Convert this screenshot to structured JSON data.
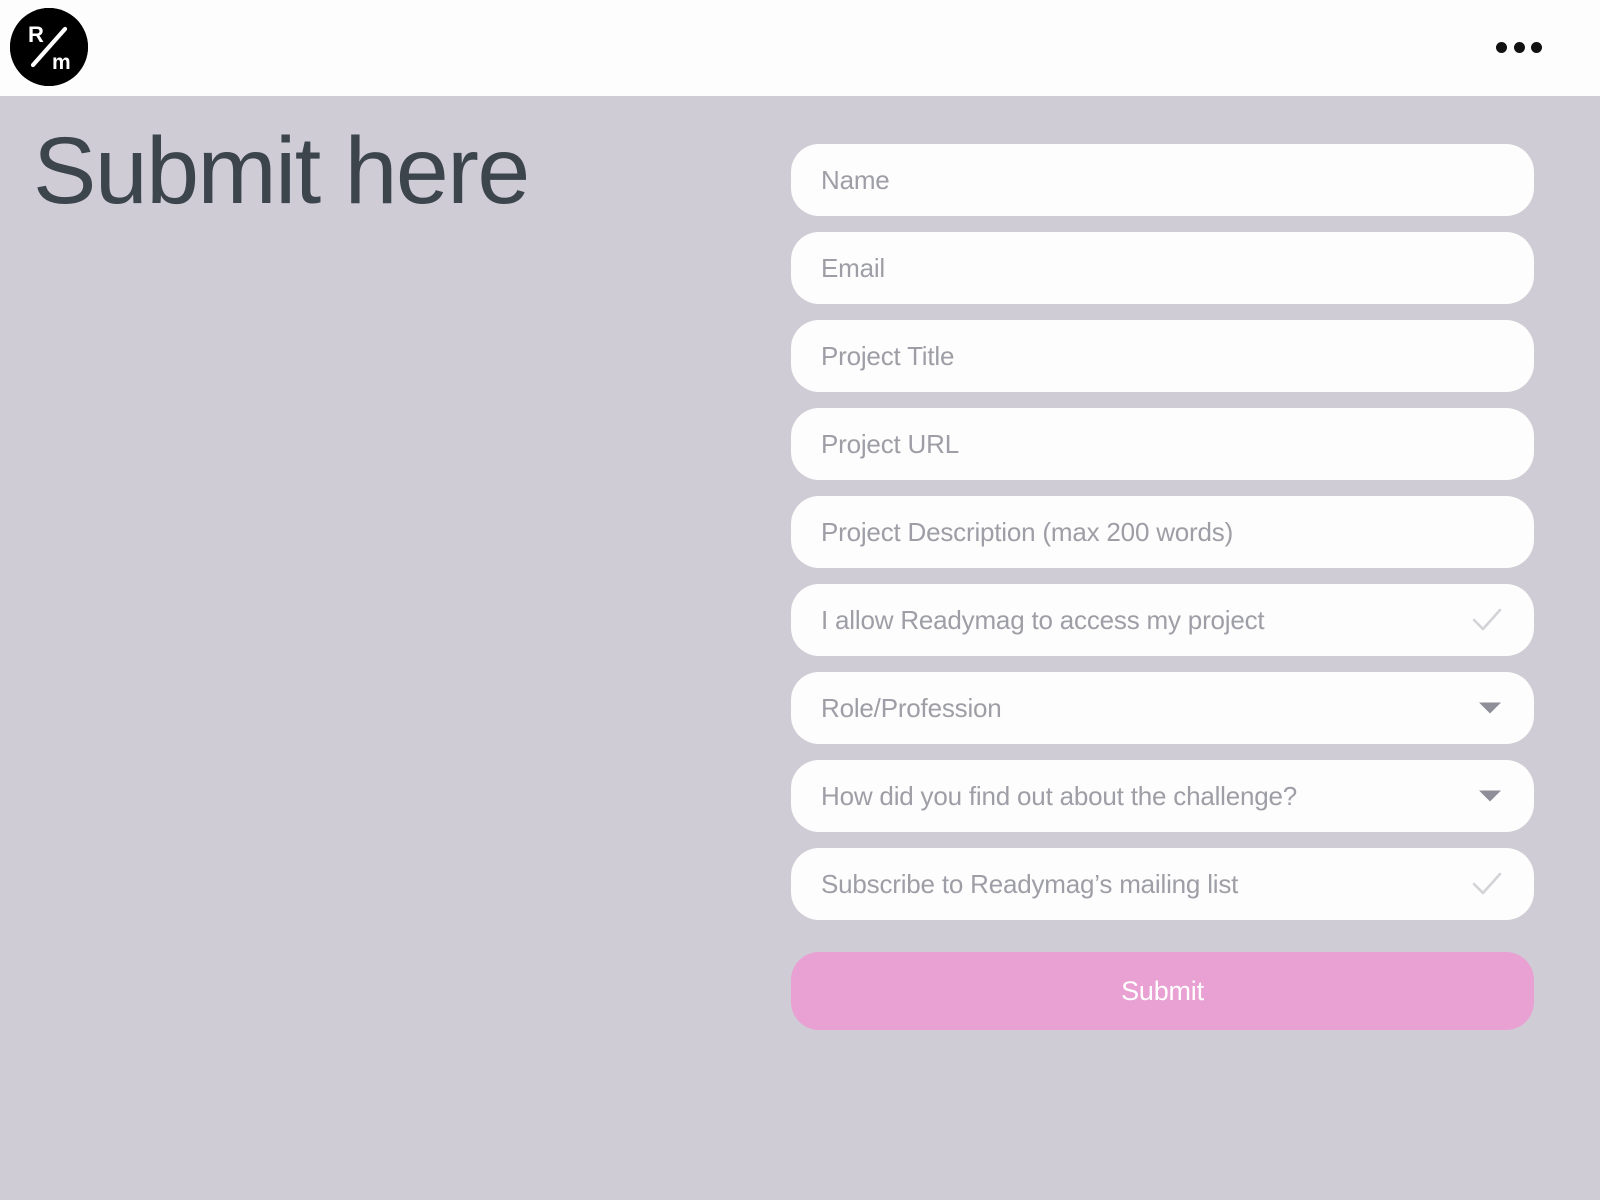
{
  "header": {
    "logo": {
      "name": "readymag-logo",
      "top_letter": "R",
      "bottom_letter": "m"
    },
    "menu": {
      "icon": "ellipsis-icon",
      "label": "More"
    }
  },
  "main": {
    "title": "Submit here",
    "form": {
      "fields": [
        {
          "name": "name",
          "type": "text",
          "placeholder": "Name"
        },
        {
          "name": "email",
          "type": "text",
          "placeholder": "Email"
        },
        {
          "name": "project-title",
          "type": "text",
          "placeholder": "Project Title"
        },
        {
          "name": "project-url",
          "type": "text",
          "placeholder": "Project URL"
        },
        {
          "name": "project-description",
          "type": "textarea",
          "placeholder": "Project Description (max 200 words)"
        },
        {
          "name": "allow-access",
          "type": "checkbox",
          "placeholder": "I allow Readymag to access my project",
          "icon": "check-icon",
          "checked": false
        },
        {
          "name": "role-profession",
          "type": "select",
          "placeholder": "Role/Profession",
          "icon": "chevron-down-icon"
        },
        {
          "name": "referral-source",
          "type": "select",
          "placeholder": "How did you find out about the challenge?",
          "icon": "chevron-down-icon"
        },
        {
          "name": "mailing-list",
          "type": "checkbox",
          "placeholder": "Subscribe to Readymag’s mailing list",
          "icon": "check-icon",
          "checked": false
        }
      ],
      "submit_label": "Submit"
    }
  },
  "colors": {
    "background": "#cfccd6",
    "header_background": "#fdfdfd",
    "field_background": "#fdfdfd",
    "placeholder_text": "#9e9ea6",
    "title_text": "#3c444c",
    "submit_background": "#e9a0d2",
    "submit_text": "#ffffff",
    "logo_background": "#000000",
    "check_icon": "#d3d3d8",
    "caret_icon": "#8e8e98"
  }
}
